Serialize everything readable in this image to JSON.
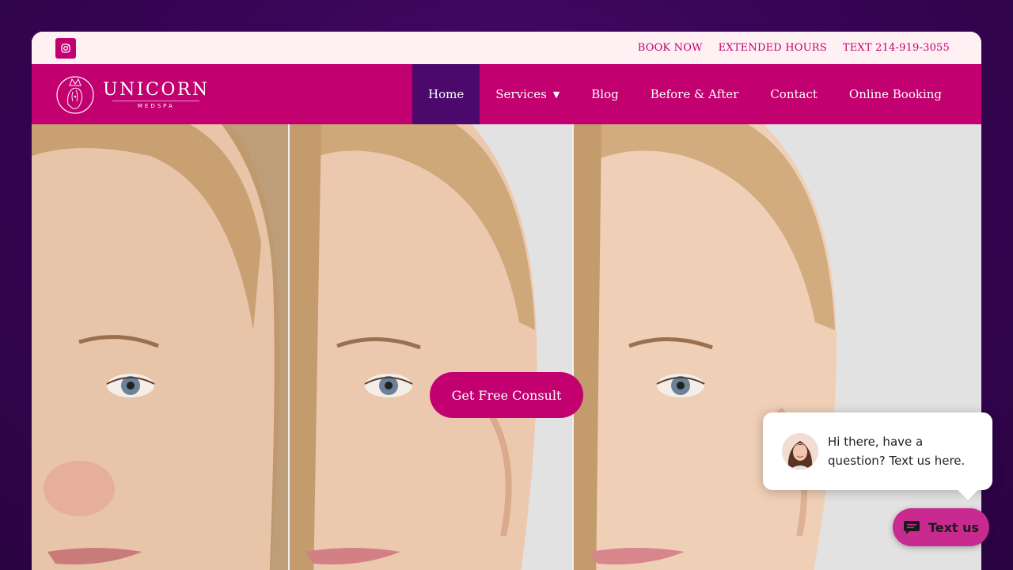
{
  "topbar": {
    "links": [
      "BOOK NOW",
      "EXTENDED HOURS",
      "TEXT 214-919-3055"
    ],
    "social_icon": "instagram-icon"
  },
  "logo": {
    "name": "UNICORN",
    "sub": "MEDSPA"
  },
  "nav": {
    "items": [
      "Home",
      "Services",
      "Blog",
      "Before & After",
      "Contact",
      "Online Booking"
    ],
    "active": "Home",
    "dropdown_item": "Services"
  },
  "hero": {
    "cta": "Get Free Consult"
  },
  "chat": {
    "message": "Hi there, have a question? Text us here.",
    "button": "Text us"
  },
  "colors": {
    "brand": "#c2006f",
    "active_nav": "#4b0a6b",
    "topbar_bg": "#fff0f4",
    "page_bg": "#3a0558"
  }
}
